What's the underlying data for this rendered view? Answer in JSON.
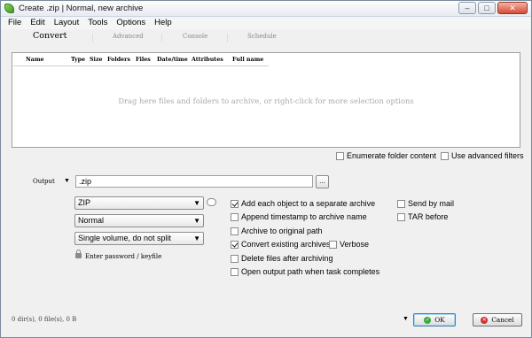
{
  "window": {
    "title": "Create .zip | Normal, new archive",
    "controls": {
      "minimize": "–",
      "maximize": "□",
      "close": "✕"
    }
  },
  "menu": [
    "File",
    "Edit",
    "Layout",
    "Tools",
    "Options",
    "Help"
  ],
  "tabs": [
    {
      "label": "Convert",
      "active": true
    },
    {
      "label": "Advanced",
      "active": false
    },
    {
      "label": "Console",
      "active": false
    },
    {
      "label": "Schedule",
      "active": false
    }
  ],
  "filelist": {
    "columns": [
      "Name",
      "Type",
      "Size",
      "Folders",
      "Files",
      "Date/time",
      "Attributes",
      "Full name"
    ],
    "empty_hint": "Drag here files and folders to archive, or right-click for more selection options"
  },
  "list_options": {
    "enumerate": {
      "label": "Enumerate folder content",
      "checked": false
    },
    "advanced_filters": {
      "label": "Use advanced filters",
      "checked": false
    }
  },
  "output": {
    "label": "Output",
    "dropdown_glyph": "▼",
    "value": ".zip",
    "browse_label": "..."
  },
  "format": {
    "selected": "ZIP",
    "arrow": "▼"
  },
  "compression": {
    "selected": "Normal",
    "arrow": "▼"
  },
  "volume": {
    "selected": "Single volume, do not split",
    "arrow": "▼"
  },
  "password_link": "Enter password / keyfile",
  "options_col1": [
    {
      "label": "Add each object to a separate archive",
      "checked": true
    },
    {
      "label": "Append timestamp to archive name",
      "checked": false
    },
    {
      "label": "Archive to original path",
      "checked": false
    },
    {
      "label": "Convert existing archives",
      "checked": true
    },
    {
      "label": "Delete files after archiving",
      "checked": false
    },
    {
      "label": "Open output path when task completes",
      "checked": false
    }
  ],
  "verbose": {
    "label": "Verbose",
    "checked": false
  },
  "options_col2": [
    {
      "label": "Send by mail",
      "checked": false
    },
    {
      "label": "TAR before",
      "checked": false
    }
  ],
  "status": {
    "text": "0 dir(s), 0 file(s), 0 B",
    "dropdown_glyph": "▼"
  },
  "buttons": {
    "ok": "OK",
    "ok_glyph": "✓",
    "cancel": "Cancel",
    "cancel_glyph": "✕"
  }
}
